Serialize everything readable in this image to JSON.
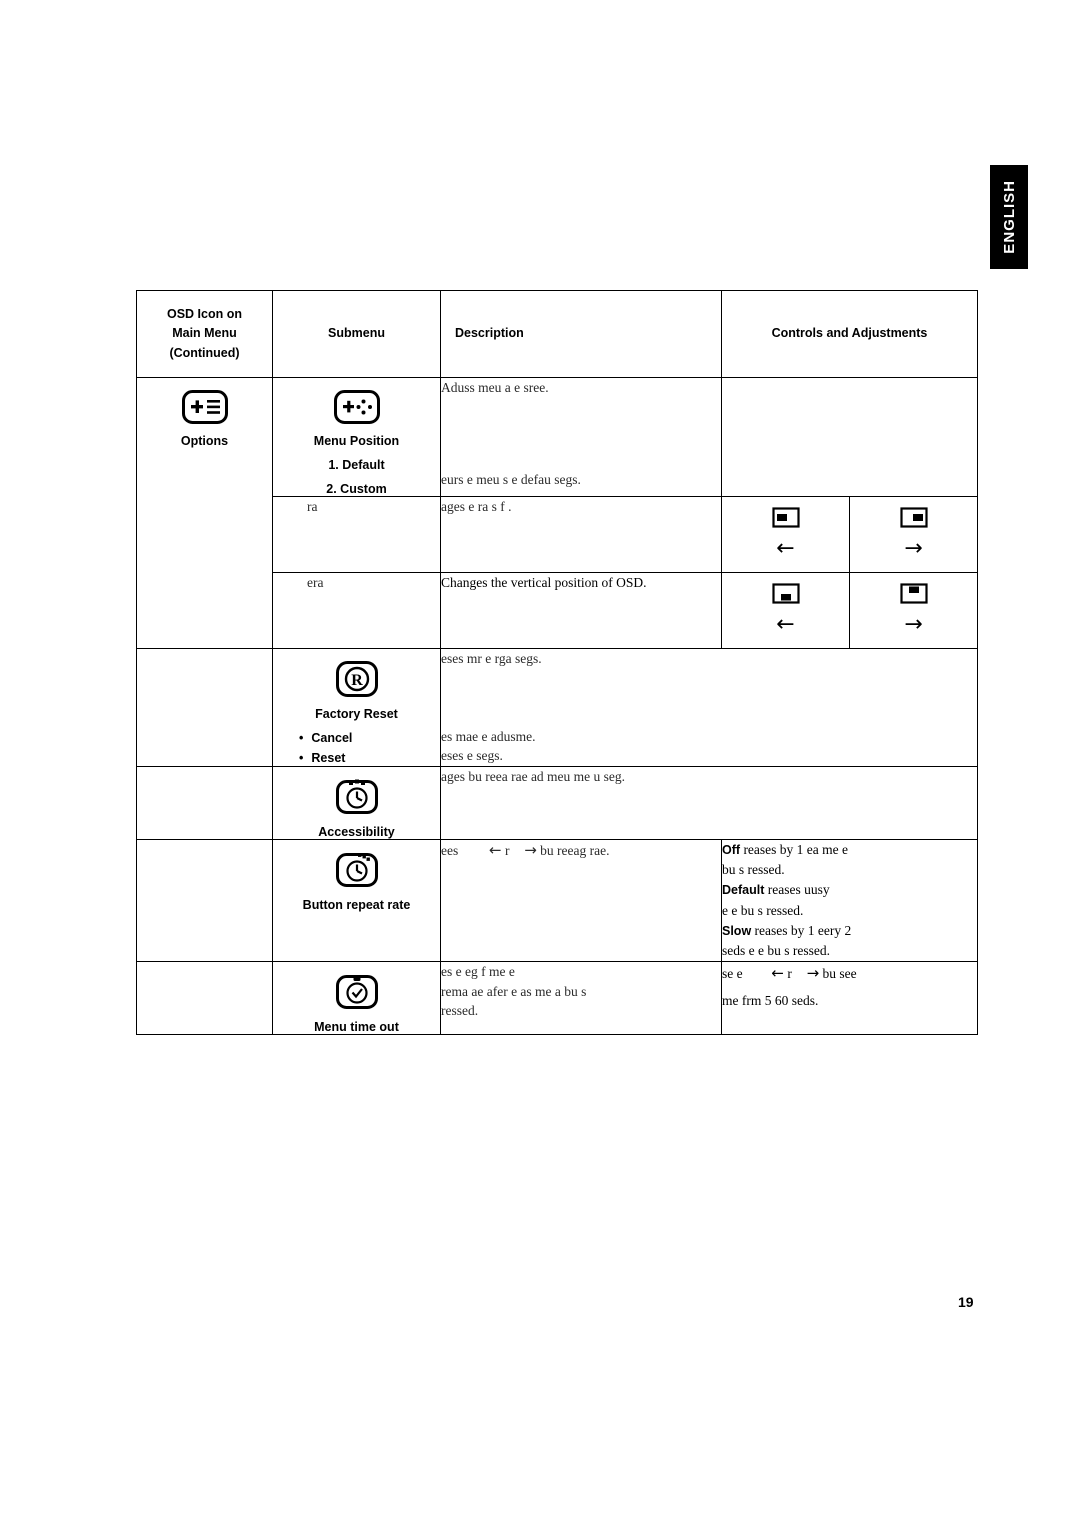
{
  "language_tab": "ENGLISH",
  "page_number": "19",
  "table": {
    "headers": {
      "col1": "OSD Icon on Main Menu (Continued)",
      "col1_line1": "OSD Icon on",
      "col1_line2": "Main Menu",
      "col1_line3": "(Continued)",
      "col2": "Submenu",
      "col3": "Description",
      "col4": "Controls and Adjustments"
    },
    "rows": [
      {
        "main_menu_label": "Options",
        "main_menu_icon": "options-list-icon",
        "submenu_icon": "menu-position-icon",
        "submenu_title": "Menu Position",
        "submenu_items": [
          "1. Default",
          "2. Custom"
        ],
        "descriptions": [
          "Aduss meu a  e sree.",
          "eurs e meu s  e defau segs."
        ]
      },
      {
        "submenu_label": "ra",
        "description": "ages e ra s f .",
        "controls": {
          "left_icon": "osd-horizontal-left-icon",
          "left_arrow": "←",
          "right_icon": "osd-horizontal-right-icon",
          "right_arrow": "→"
        }
      },
      {
        "submenu_label": "era",
        "description": "Changes the vertical position of OSD.",
        "controls": {
          "left_icon": "osd-vertical-down-icon",
          "left_arrow": "←",
          "right_icon": "osd-vertical-up-icon",
          "right_arrow": "→"
        }
      },
      {
        "submenu_icon": "factory-reset-icon",
        "submenu_title": "Factory Reset",
        "submenu_items": [
          "Cancel",
          "Reset"
        ],
        "descriptions": [
          "eses mr  e rga segs.",
          "es  mae e adusme.",
          "eses e segs."
        ]
      },
      {
        "submenu_icon": "accessibility-clock-icon",
        "submenu_title": "Accessibility",
        "description": "ages bu reea rae ad meu me u seg."
      },
      {
        "submenu_icon": "button-repeat-rate-icon",
        "submenu_title": "Button repeat rate",
        "description_prefix": "ees",
        "description_arrow_left": "←",
        "description_mid": "r",
        "description_arrow_right": "→",
        "description_suffix": "bu reeag rae.",
        "controls_lines": [
          {
            "bold": "Off",
            "text": "reases by 1 ea me e"
          },
          {
            "bold": "",
            "text": "bu s ressed."
          },
          {
            "bold": "Default",
            "text": "reases uusy"
          },
          {
            "bold": "",
            "text": "e e bu s ressed."
          },
          {
            "bold": "Slow",
            "text": "reases by 1 eery 2"
          },
          {
            "bold": "",
            "text": "seds e e bu s ressed."
          }
        ]
      },
      {
        "submenu_icon": "menu-time-out-icon",
        "submenu_title": "Menu time out",
        "description_lines": [
          "es e eg f me e",
          "rema ae afer e as me a bu s",
          "ressed."
        ],
        "controls_line1_prefix": "se e",
        "controls_arrow_left": "←",
        "controls_mid": "r",
        "controls_arrow_right": "→",
        "controls_line1_suffix": "bu see",
        "controls_line2": "me frm 5  60 seds."
      }
    ]
  }
}
